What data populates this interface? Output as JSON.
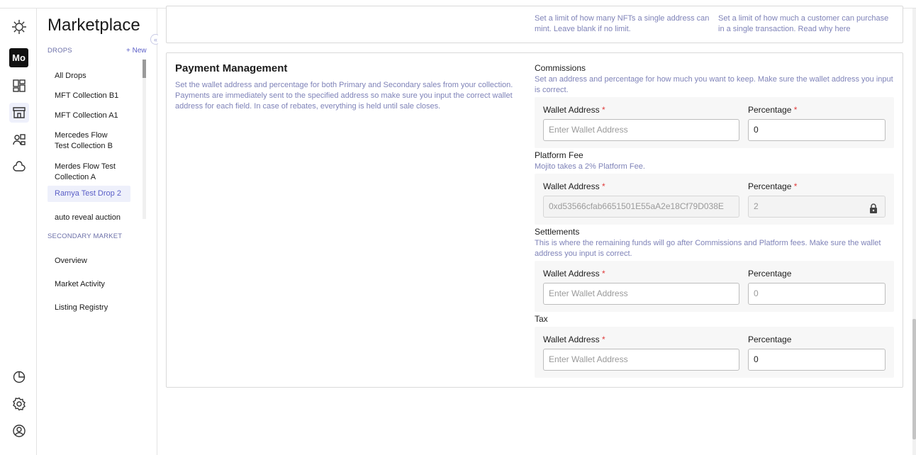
{
  "rail": {
    "avatar": "Mo"
  },
  "sidebar": {
    "title": "Marketplace",
    "drops_label": "DROPS",
    "new_label": "+ New",
    "drops": [
      "All Drops",
      "MFT Collection B1",
      "MFT Collection A1",
      "Mercedes Flow Test Collection B",
      "Merdes Flow Test Collection A",
      "Ramya Test Drop 2",
      "auto reveal auction"
    ],
    "secondary_label": "SECONDARY MARKET",
    "secondary": [
      "Overview",
      "Market Activity",
      "Listing Registry"
    ]
  },
  "top_card": {
    "hint_left": "Set a limit of how many NFTs a single address can mint. Leave blank if no limit.",
    "hint_right": "Set a limit of how much a customer can purchase in a single transaction. Read why here"
  },
  "payment": {
    "title": "Payment Management",
    "description": "Set the wallet address and percentage for both Primary and Secondary sales from your collection. Payments are immediately sent to the specified address so make sure you input the correct wallet address for each field. In case of rebates, everything is held until sale closes.",
    "wallet_label": "Wallet Address",
    "percentage_label": "Percentage",
    "required_mark": "*",
    "wallet_placeholder": "Enter Wallet Address",
    "commissions": {
      "label": "Commissions",
      "hint": "Set an address and percentage for how much you want to keep. Make sure the wallet address you input is correct.",
      "wallet_value": "",
      "percentage_value": "0"
    },
    "platform_fee": {
      "label": "Platform Fee",
      "hint": "Mojito takes a 2% Platform Fee.",
      "wallet_value": "0xd53566cfab6651501E55aA2e18Cf79D038E",
      "percentage_value": "2"
    },
    "settlements": {
      "label": "Settlements",
      "hint": "This is where the remaining funds will go after Commissions and Platform fees. Make sure the wallet address you input is correct.",
      "wallet_value": "",
      "percentage_placeholder": "0"
    },
    "tax": {
      "label": "Tax",
      "wallet_value": "",
      "percentage_value": "0"
    }
  }
}
